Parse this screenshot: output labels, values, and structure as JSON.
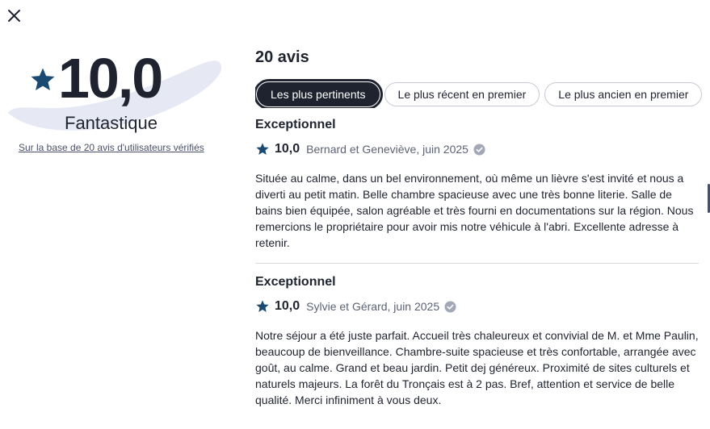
{
  "close_icon": "close-icon",
  "summary": {
    "score": "10,0",
    "rating_word": "Fantastique",
    "based_on": "Sur la base de 20 avis d'utilisateurs vérifiés",
    "star_color": "#1a4971",
    "swoosh_color": "#e6e9f3"
  },
  "reviews_header": {
    "count_label": "20 avis"
  },
  "sort_tabs": [
    {
      "label": "Les plus pertinents",
      "active": true
    },
    {
      "label": "Le plus récent en premier",
      "active": false
    },
    {
      "label": "Le plus ancien en premier",
      "active": false
    }
  ],
  "reviews": [
    {
      "title": "Exceptionnel",
      "score": "10,0",
      "author": "Bernard et Geneviève, juin 2025",
      "text": "Située au calme, dans un bel environnement, où même un lièvre s'est invité et nous a diverti au petit matin. Belle chambre spacieuse avec une très bonne literie. Salle de bains bien équipée, salon agréable et très fourni en documentations sur la région. Nous remercions le propriétaire pour avoir mis notre véhicule à l'abri. Excellente adresse à retenir."
    },
    {
      "title": "Exceptionnel",
      "score": "10,0",
      "author": "Sylvie et Gérard, juin 2025",
      "text": "Notre séjour a été juste parfait. Accueil très chaleureux et convivial de M. et Mme Paulin, beaucoup de bienveillance. Chambre-suite spacieuse et très confortable, arrangée avec goût, au calme. Grand et beau jardin. Petit dej généreux. Proximité de sites culturels et naturels majeurs. La forêt du Tronçais est à 2 pas. Bref, attention et service de belle qualité. Merci infiniment à vous deux."
    }
  ]
}
